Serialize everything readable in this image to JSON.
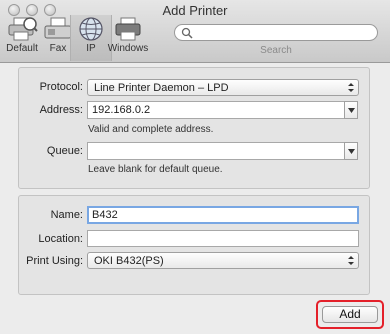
{
  "window": {
    "title": "Add Printer"
  },
  "toolbar": {
    "items": [
      {
        "label": "Default",
        "icon": "default-printer-icon"
      },
      {
        "label": "Fax",
        "icon": "fax-icon"
      },
      {
        "label": "IP",
        "icon": "globe-icon"
      },
      {
        "label": "Windows",
        "icon": "windows-printer-icon"
      }
    ],
    "search": {
      "placeholder": "",
      "label": "Search"
    }
  },
  "connection": {
    "protocol": {
      "label": "Protocol:",
      "value": "Line Printer Daemon – LPD"
    },
    "address": {
      "label": "Address:",
      "value": "192.168.0.2",
      "hint": "Valid and complete address."
    },
    "queue": {
      "label": "Queue:",
      "value": "",
      "hint": "Leave blank for default queue."
    }
  },
  "details": {
    "name": {
      "label": "Name:",
      "value": "B432"
    },
    "location": {
      "label": "Location:",
      "value": ""
    },
    "print_using": {
      "label": "Print Using:",
      "value": "OKI B432(PS)"
    }
  },
  "actions": {
    "add_label": "Add"
  },
  "colors": {
    "highlight": "#e4202a",
    "focus_ring": "#79a7e3"
  }
}
